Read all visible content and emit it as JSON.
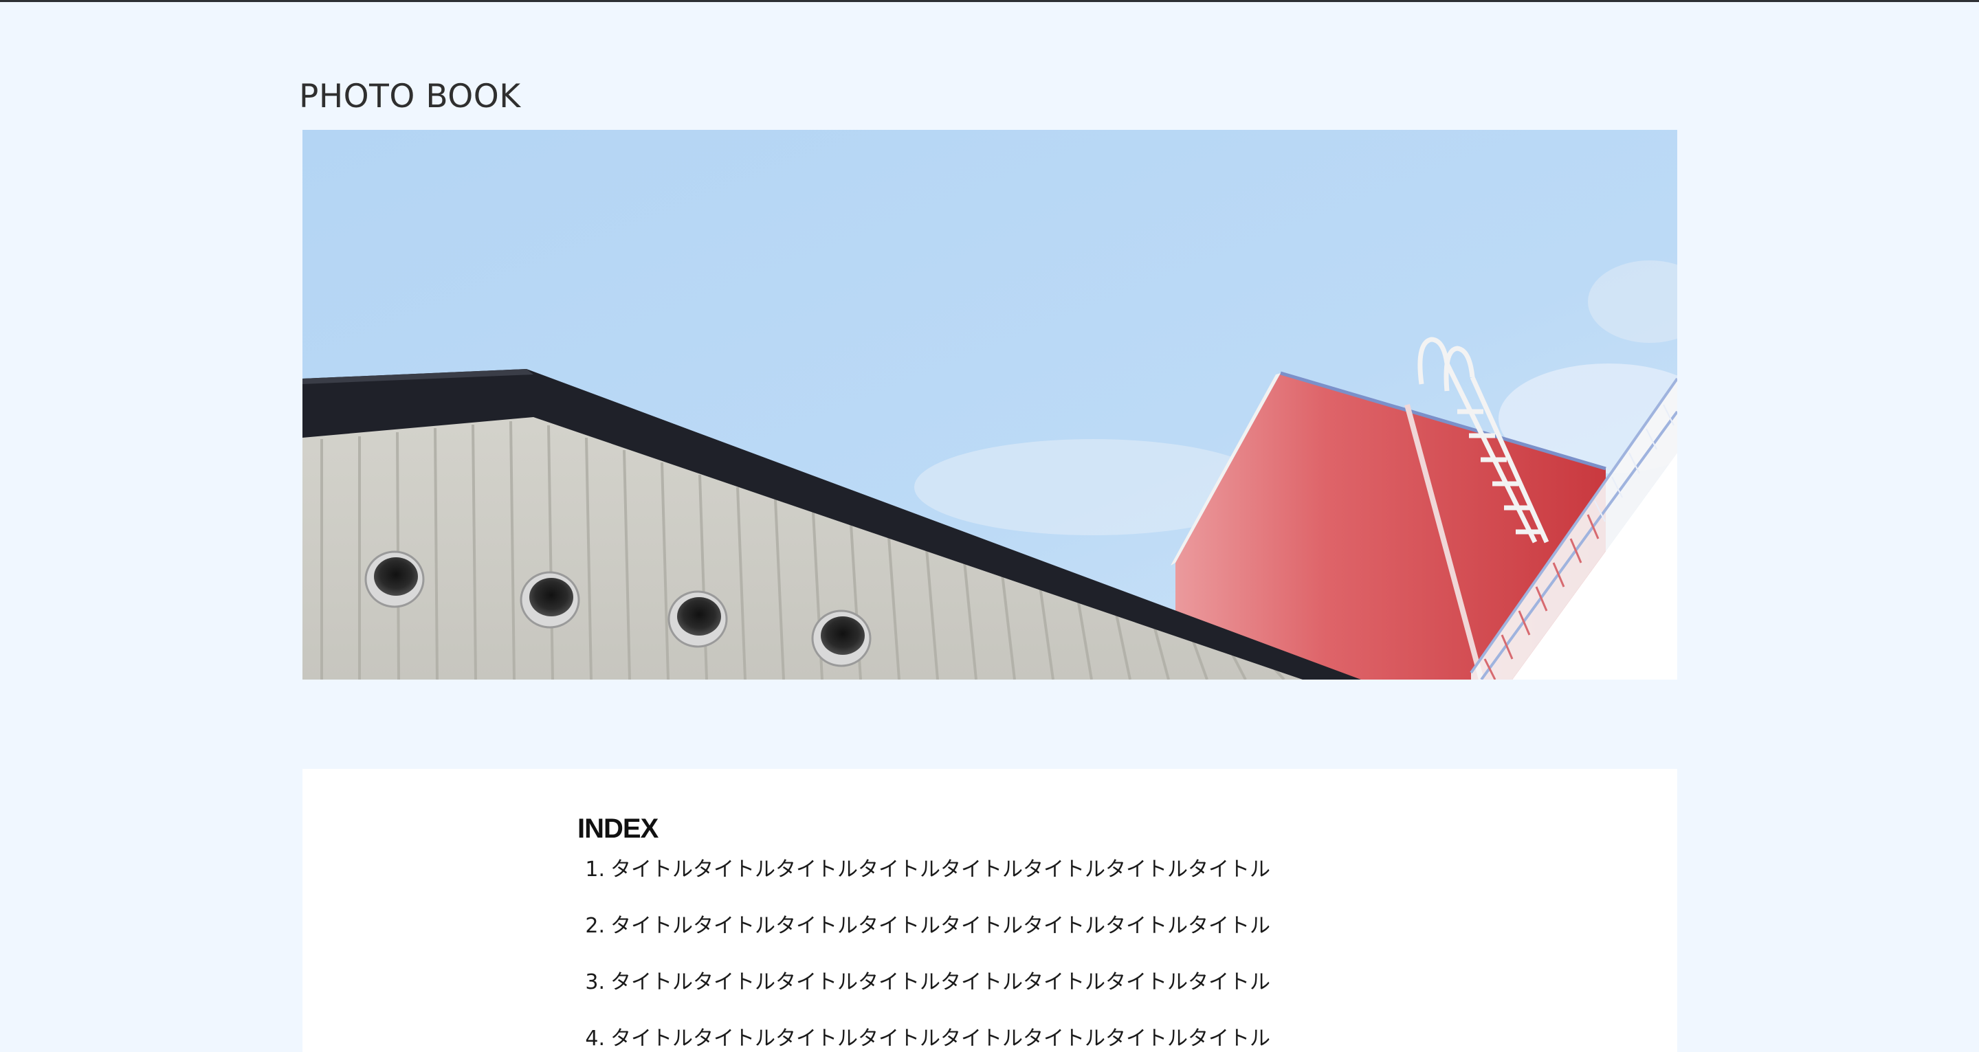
{
  "site": {
    "title": "PHOTO BOOK"
  },
  "hero": {
    "image_description_icon": "photo-building-roof-icon"
  },
  "index": {
    "heading": "INDEX",
    "items": [
      {
        "number": "1.",
        "label": "タイトルタイトルタイトルタイトルタイトルタイトルタイトルタイトル"
      },
      {
        "number": "2.",
        "label": "タイトルタイトルタイトルタイトルタイトルタイトルタイトルタイトル"
      },
      {
        "number": "3.",
        "label": "タイトルタイトルタイトルタイトルタイトルタイトルタイトルタイトル"
      },
      {
        "number": "4.",
        "label": "タイトルタイトルタイトルタイトルタイトルタイトルタイトルタイトル"
      }
    ]
  },
  "colors": {
    "page_background": "#f0f7ff",
    "panel_background": "#ffffff",
    "sky": "#b7d8f6",
    "roof_dark": "#1f2129",
    "wall_red": "#d6474c",
    "siding": "#dcdbd4"
  }
}
